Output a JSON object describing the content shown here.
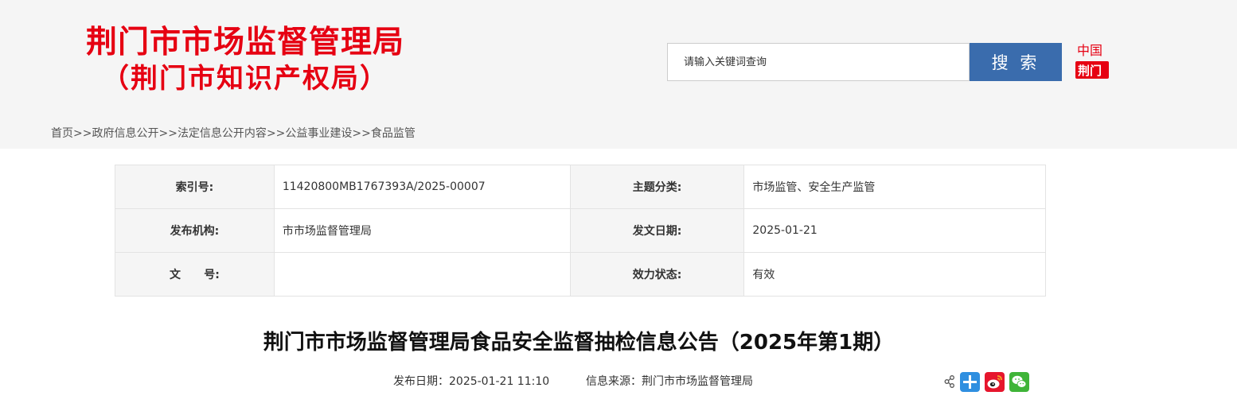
{
  "header": {
    "title_line1": "荆门市市场监督管理局",
    "title_line2": "（荆门市知识产权局）",
    "search": {
      "placeholder": "请输入关键词查询",
      "button_label": "搜 索"
    },
    "logo_text_top": "中国",
    "logo_text_bottom": "荆门"
  },
  "breadcrumb": {
    "items": [
      "首页",
      "政府信息公开",
      "法定信息公开内容",
      "公益事业建设",
      "食品监管"
    ],
    "separator": ">>"
  },
  "meta_table": {
    "rows": [
      {
        "label1": "索引号:",
        "value1": "11420800MB1767393A/2025-00007",
        "label2": "主题分类:",
        "value2": "市场监管、安全生产监管"
      },
      {
        "label1": "发布机构:",
        "value1": "市市场监督管理局",
        "label2": "发文日期:",
        "value2": "2025-01-21"
      },
      {
        "label1": "文      号:",
        "value1": "",
        "label2": "效力状态:",
        "value2": "有效"
      }
    ]
  },
  "article": {
    "title": "荆门市市场监督管理局食品安全监督抽检信息公告（2025年第1期）",
    "publish_date": "发布日期：2025-01-21 11:10",
    "source": "信息来源：荆门市市场监督管理局"
  },
  "share": {
    "icons": [
      "share-toggle-icon",
      "qzone-plus-icon",
      "weibo-icon",
      "wechat-icon"
    ]
  },
  "colors": {
    "title_red": "#e60012",
    "search_button_blue": "#3a6cad",
    "header_bg": "#f5f5f5"
  }
}
